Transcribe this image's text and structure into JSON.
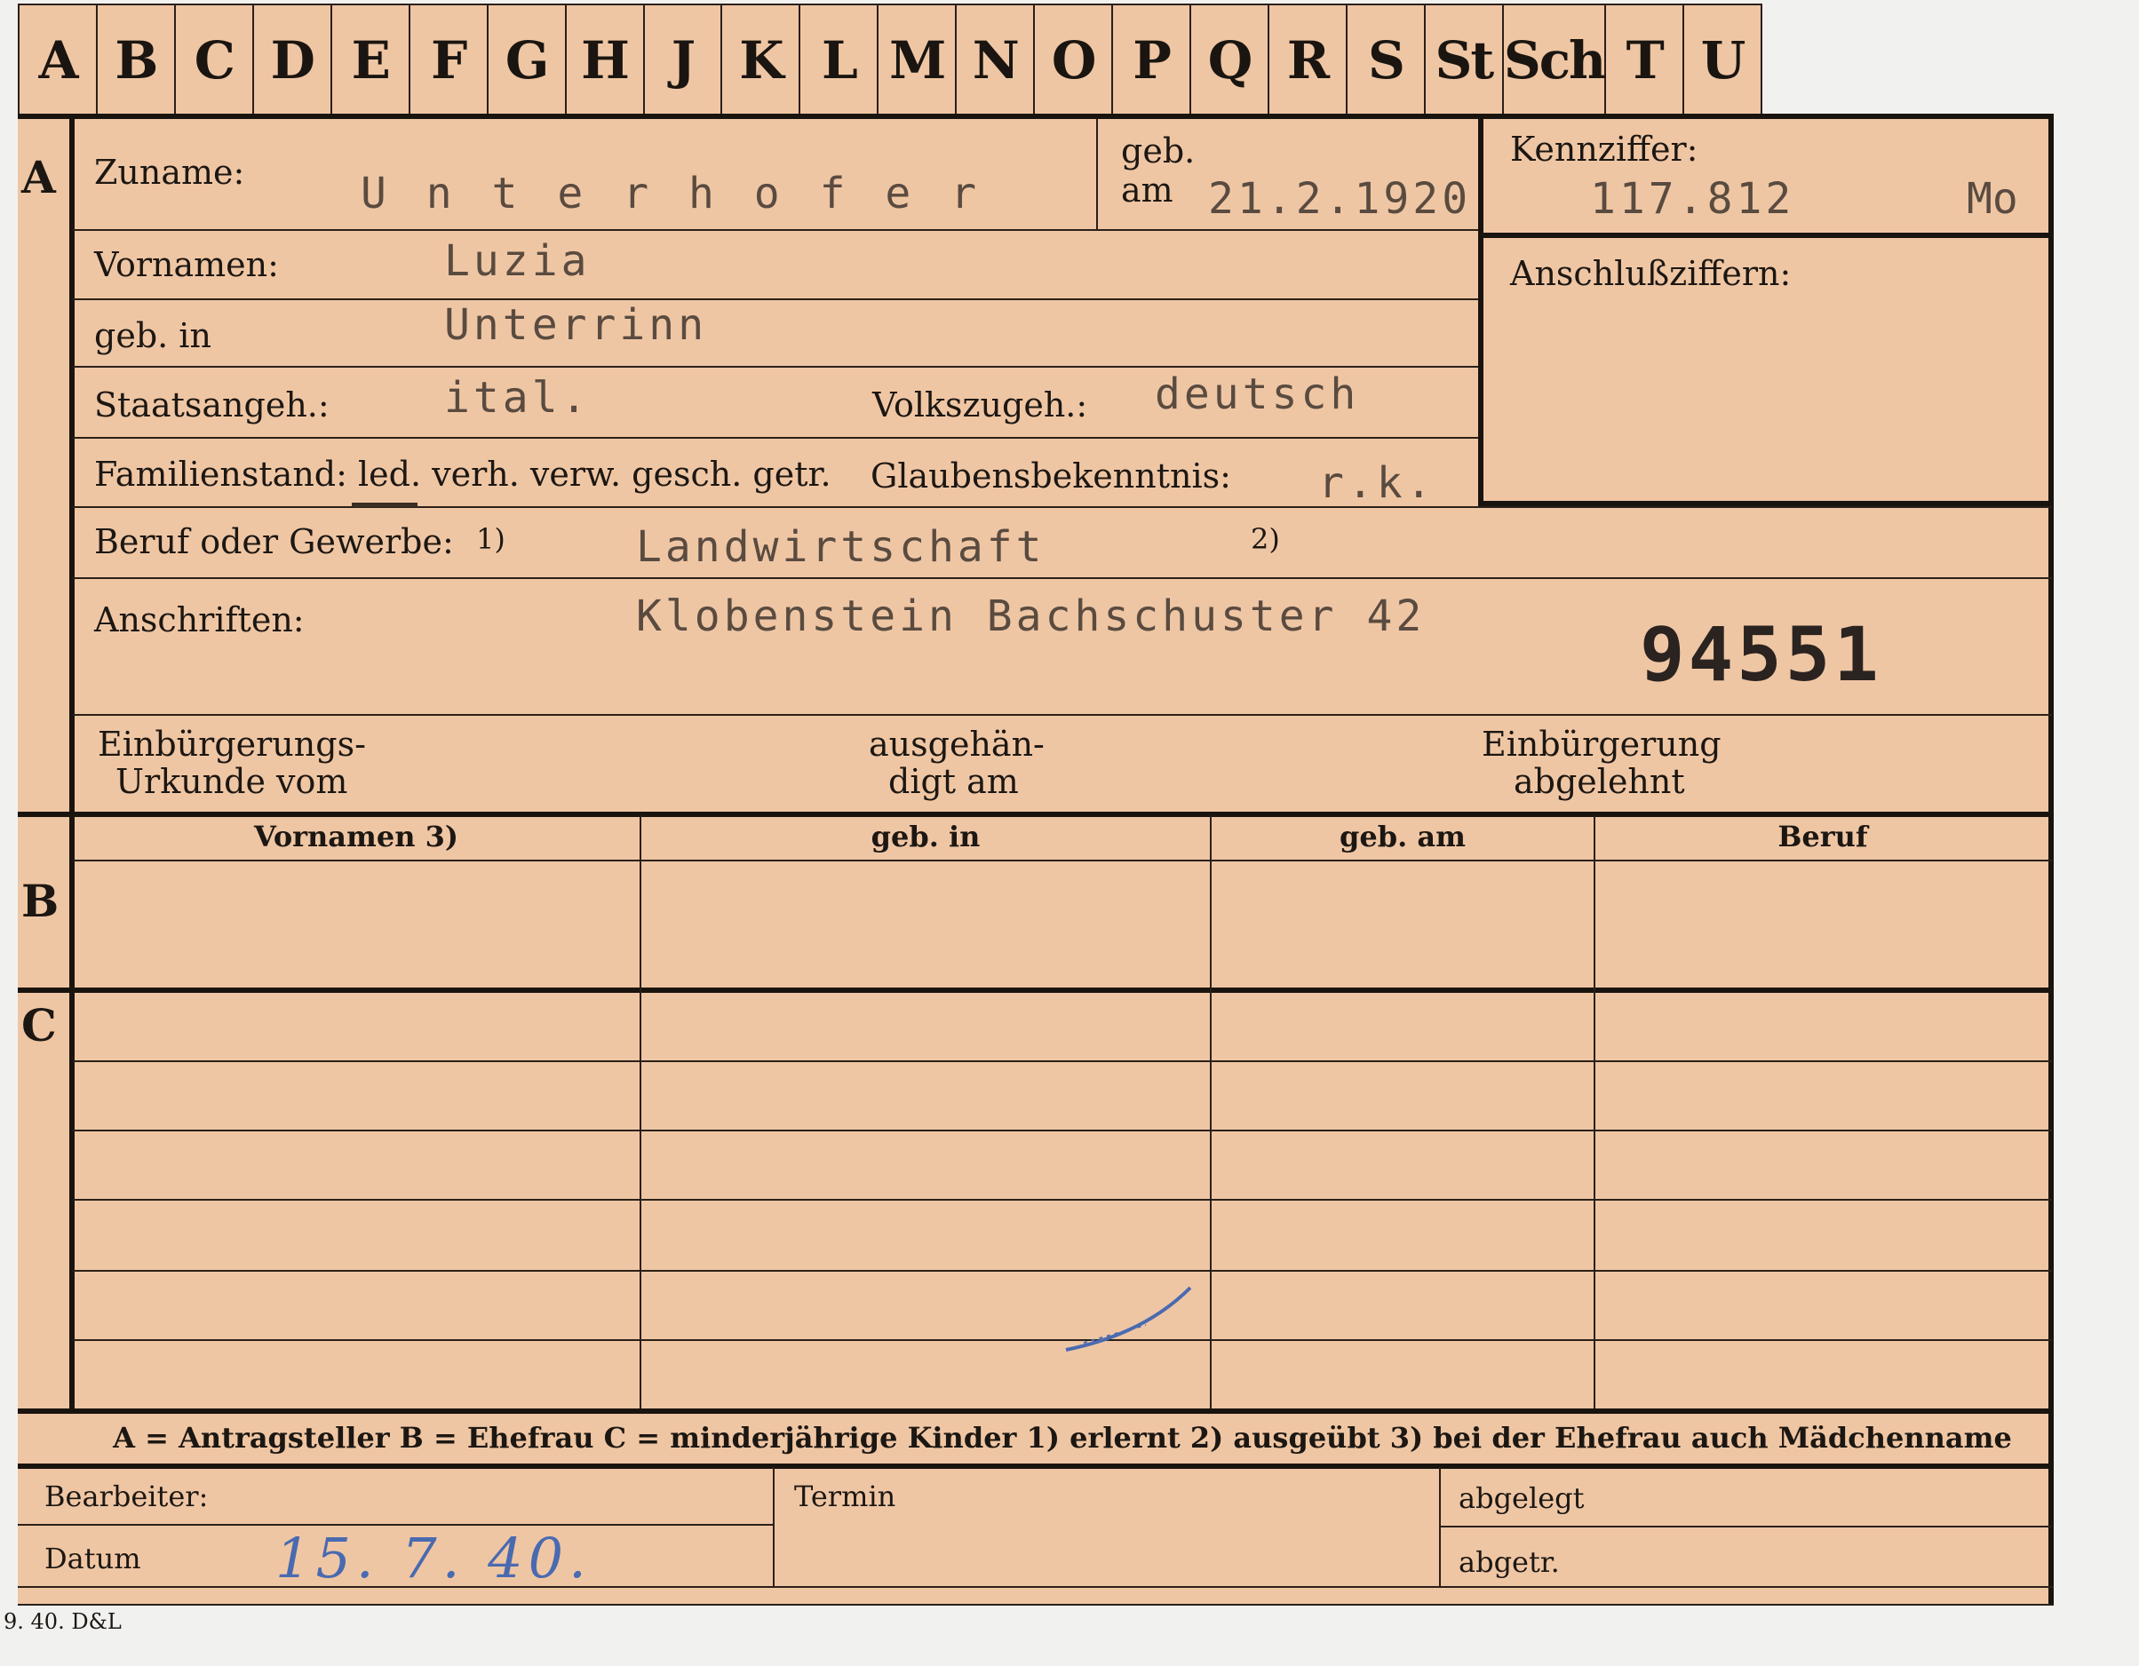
{
  "tabs": [
    "A",
    "B",
    "C",
    "D",
    "E",
    "F",
    "G",
    "H",
    "J",
    "K",
    "L",
    "M",
    "N",
    "O",
    "P",
    "Q",
    "R",
    "S",
    "St",
    "Sch",
    "T",
    "U"
  ],
  "sections": {
    "a": "A",
    "b": "B",
    "c": "C"
  },
  "section_a": {
    "zuname_label": "Zuname:",
    "zuname_value": "U n t e r h o f e r",
    "geb_label": "geb.",
    "am_label": "am",
    "geb_am_value": "21.2.1920",
    "kennziffer_label": "Kennziffer:",
    "kennziffer_value": "117.812",
    "kennziffer_suffix": "Mo",
    "anschluss_label": "Anschlußziffern:",
    "vornamen_label": "Vornamen:",
    "vornamen_value": "Luzia",
    "geb_in_label": "geb. in",
    "geb_in_value": "Unterrinn",
    "staatsangeh_label": "Staatsangeh.:",
    "staatsangeh_value": "ital.",
    "volkszugeh_label": "Volkszugeh.:",
    "volkszugeh_value": "deutsch",
    "familienstand_label": "Familienstand: led. verh. verw. gesch. getr.",
    "glaubens_label": "Glaubensbekenntnis:",
    "glaubens_value": "r.k.",
    "beruf_label": "Beruf oder Gewerbe:",
    "beruf_note1": "1)",
    "beruf_value": "Landwirtschaft",
    "beruf_note2": "2)",
    "anschriften_label": "Anschriften:",
    "anschriften_value": "Klobenstein Bachschuster 42",
    "number_stamp": "94551",
    "einb_urkunde_line1": "Einbürgerungs-",
    "einb_urkunde_line2": "Urkunde vom",
    "ausgehaendigt_line1": "ausgehän-",
    "ausgehaendigt_line2": "digt am",
    "einb_abgelehnt_line1": "Einbürgerung",
    "einb_abgelehnt_line2": "abgelehnt"
  },
  "section_b": {
    "columns": [
      "Vornamen 3)",
      "geb. in",
      "geb. am",
      "Beruf"
    ]
  },
  "legend": "A = Antragsteller   B = Ehefrau   C = minderjährige Kinder   1) erlernt   2) ausgeübt   3) bei der Ehefrau auch Mädchenname",
  "footer": {
    "bearbeiter_label": "Bearbeiter:",
    "datum_label": "Datum",
    "datum_value": "15. 7. 40.",
    "termin_label": "Termin",
    "abgelegt_label": "abgelegt",
    "abgetr_label": "abgetr.",
    "print_mark": "9. 40. D&L"
  },
  "colors": {
    "card": "#efc6a4",
    "ink": "#1c1712",
    "typed": "#5a4b40",
    "pen": "#4a6ab0"
  }
}
